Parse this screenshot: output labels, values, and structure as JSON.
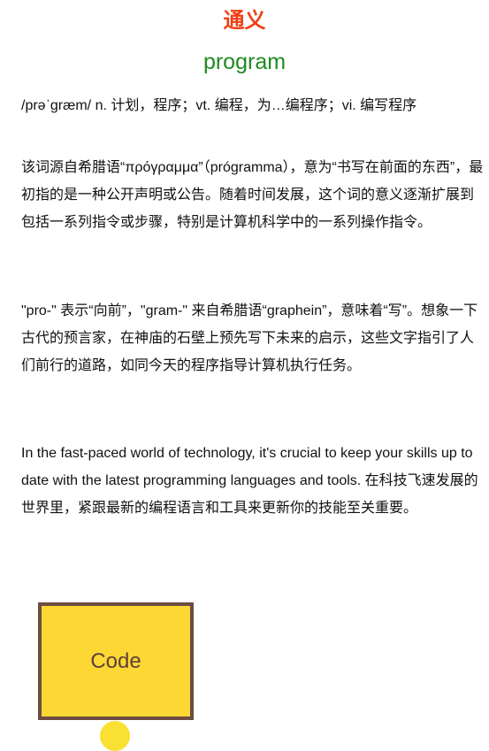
{
  "header": {
    "brand": "通义",
    "word": "program"
  },
  "entry": {
    "pronunciation_line": "/prəˈɡræm/ n. 计划，程序；vt. 编程，为…编程序；vi. 编写程序",
    "etymology": "该词源自希腊语“πρόγραμμα”（prógramma），意为“书写在前面的东西”，最初指的是一种公开声明或公告。随着时间发展，这个词的意义逐渐扩展到包括一系列指令或步骤，特别是计算机科学中的一系列操作指令。",
    "mnemonic": "\"pro-\" 表示“向前”，\"gram-\" 来自希腊语“graphein”，意味着“写”。想象一下古代的预言家，在神庙的石壁上预先写下未来的启示，这些文字指引了人们前行的道路，如同今天的程序指导计算机执行任务。",
    "example": "In the fast-paced world of technology, it's crucial to keep your skills up to date with the latest programming languages and tools. 在科技飞速发展的世界里，紧跟最新的编程语言和工具来更新你的技能至关重要。"
  },
  "card": {
    "label": "Code"
  },
  "colors": {
    "brand": "#ee3f14",
    "word": "#1f8a1f",
    "card_fill": "#fdd835",
    "card_border": "#6d4c41",
    "dot": "#fbe034"
  }
}
